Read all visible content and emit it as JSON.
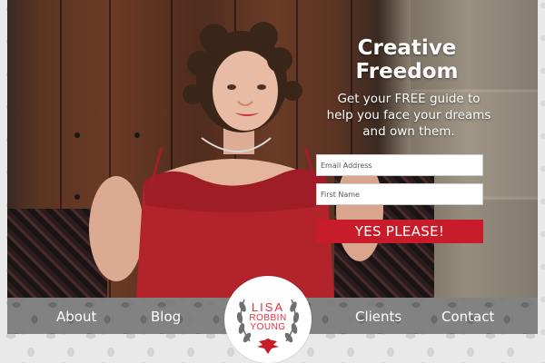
{
  "hero": {
    "title_line1": "Creative",
    "title_line2": "Freedom",
    "subtitle": "Get your FREE guide to help you face your dreams and own them."
  },
  "form": {
    "email_placeholder": "Email Address",
    "first_name_placeholder": "First Name",
    "submit_label": "YES PLEASE!"
  },
  "nav": {
    "about": "About",
    "blog": "Blog",
    "clients": "Clients",
    "contact": "Contact"
  },
  "logo": {
    "line1": "LISA",
    "line2": "ROBBIN",
    "line3": "YOUNG",
    "emblem_icon": "eagle-crest-icon"
  },
  "colors": {
    "accent_red": "#c91c2a",
    "logo_red": "#e5323e",
    "nav_gray": "#787878"
  }
}
